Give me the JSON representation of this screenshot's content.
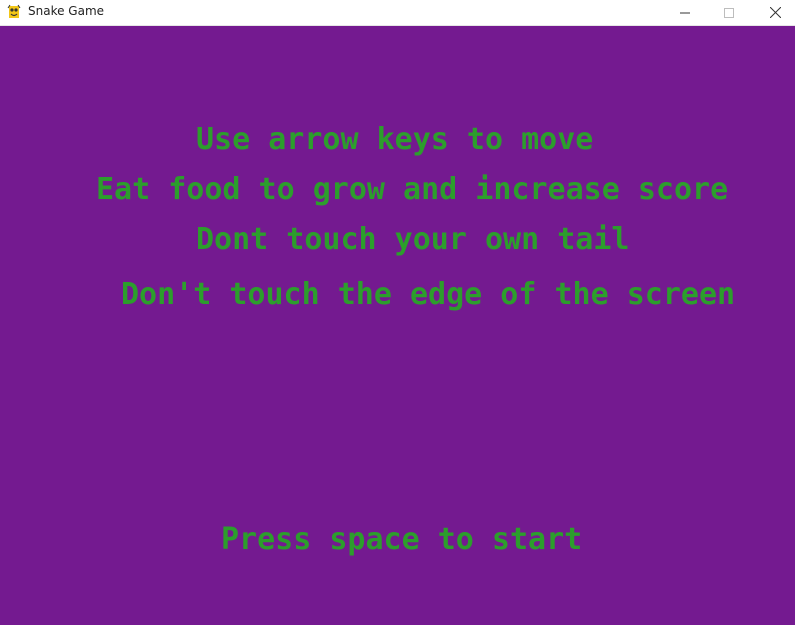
{
  "window": {
    "title": "Snake Game",
    "icon": "pygame-snake-icon"
  },
  "titlebar_buttons": {
    "minimize": "minimize-icon",
    "maximize": "maximize-icon",
    "close": "close-icon"
  },
  "game": {
    "background_color": "#741a90",
    "text_color": "#2c9e2c",
    "instructions": [
      "Use arrow keys to move",
      "Eat food to grow and increase score",
      "Dont touch your own tail",
      "Don't touch the edge of the screen"
    ],
    "start_prompt": "Press space to start"
  }
}
